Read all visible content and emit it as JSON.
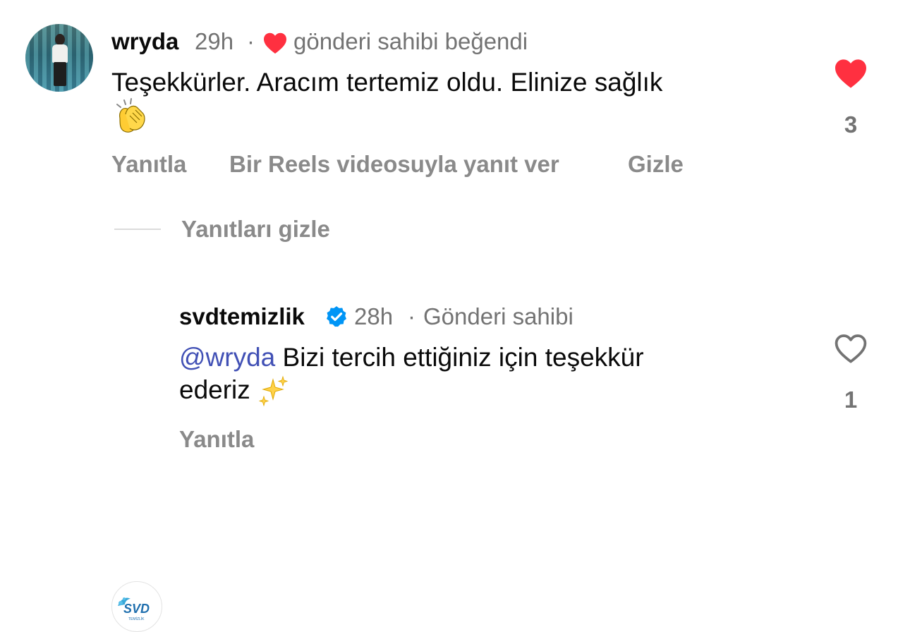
{
  "comments": [
    {
      "username": "wryda",
      "time": "29h",
      "separator": "·",
      "liked_by_author_label": "gönderi sahibi beğendi",
      "text": "Teşekkürler. Aracım tertemiz oldu. Elinize sağlık",
      "emoji": "clapping-hands-emoji",
      "likes": "3",
      "liked": true,
      "actions": {
        "reply": "Yanıtla",
        "reels_reply": "Bir Reels videosuyla yanıt ver",
        "hide": "Gizle"
      }
    },
    {
      "username": "svdtemizlik",
      "verified": true,
      "time": "28h",
      "separator": "·",
      "author_label": "Gönderi sahibi",
      "mention": "@wryda",
      "text_line1": " Bizi tercih ettiğiniz için teşekkür",
      "text_line2": "ederiz",
      "emoji": "sparkles-emoji",
      "likes": "1",
      "liked": false,
      "actions": {
        "reply": "Yanıtla"
      },
      "avatar_logo_text": "SVD",
      "avatar_logo_subtext": "TEMİZLİK"
    }
  ],
  "thread": {
    "hide_replies": "Yanıtları gizle"
  },
  "colors": {
    "like_red": "#ff3040",
    "verified_blue": "#0095f6",
    "mention": "#4150b5",
    "meta_gray": "#737373"
  }
}
